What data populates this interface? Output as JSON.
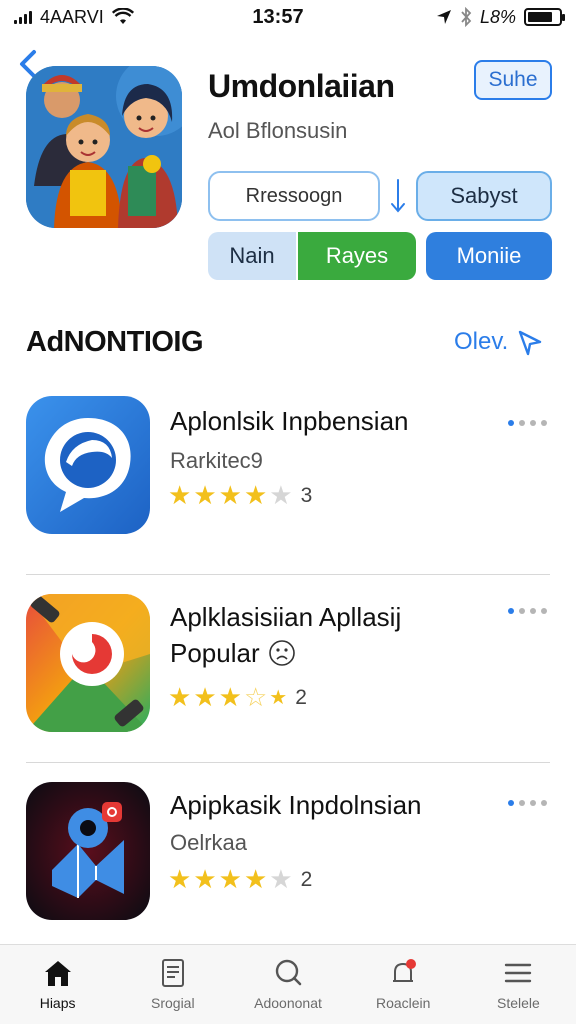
{
  "status_bar": {
    "carrier": "4AARVI",
    "time": "13:57",
    "battery": "L8%",
    "battery_level": 0.8
  },
  "header": {
    "app_title": "Umdonlaiian",
    "app_subtitle": "Aol Bflonsusin",
    "top_button": "Suhe",
    "field_text": "Rressoogn",
    "select_button": "Sabyst",
    "segments": [
      "Nain",
      "Rayes",
      "Moniie"
    ]
  },
  "section": {
    "title": "AdNONTIOIG",
    "link": "Olev."
  },
  "apps": [
    {
      "title": "Aplonlsik Inpbensian",
      "subtitle": "Rarkitec9",
      "rating": 4,
      "count": "3"
    },
    {
      "title": "Aplklasisiian  Apllasij",
      "title2": "Popular",
      "subtitle": "",
      "rating": 3,
      "count": "2"
    },
    {
      "title": "Apipkasik Inpdolnsian",
      "subtitle": "Oelrkaa",
      "rating": 4,
      "count": "2"
    }
  ],
  "tabs": [
    {
      "label": "Hiaps",
      "icon": "home-icon"
    },
    {
      "label": "Srogial",
      "icon": "document-icon"
    },
    {
      "label": "Adoononat",
      "icon": "search-icon"
    },
    {
      "label": "Roaclein",
      "icon": "bell-icon"
    },
    {
      "label": "Stelele",
      "icon": "menu-icon"
    }
  ],
  "colors": {
    "accent": "#2b7de9",
    "green": "#3aaa3e",
    "star": "#f2c01c"
  }
}
